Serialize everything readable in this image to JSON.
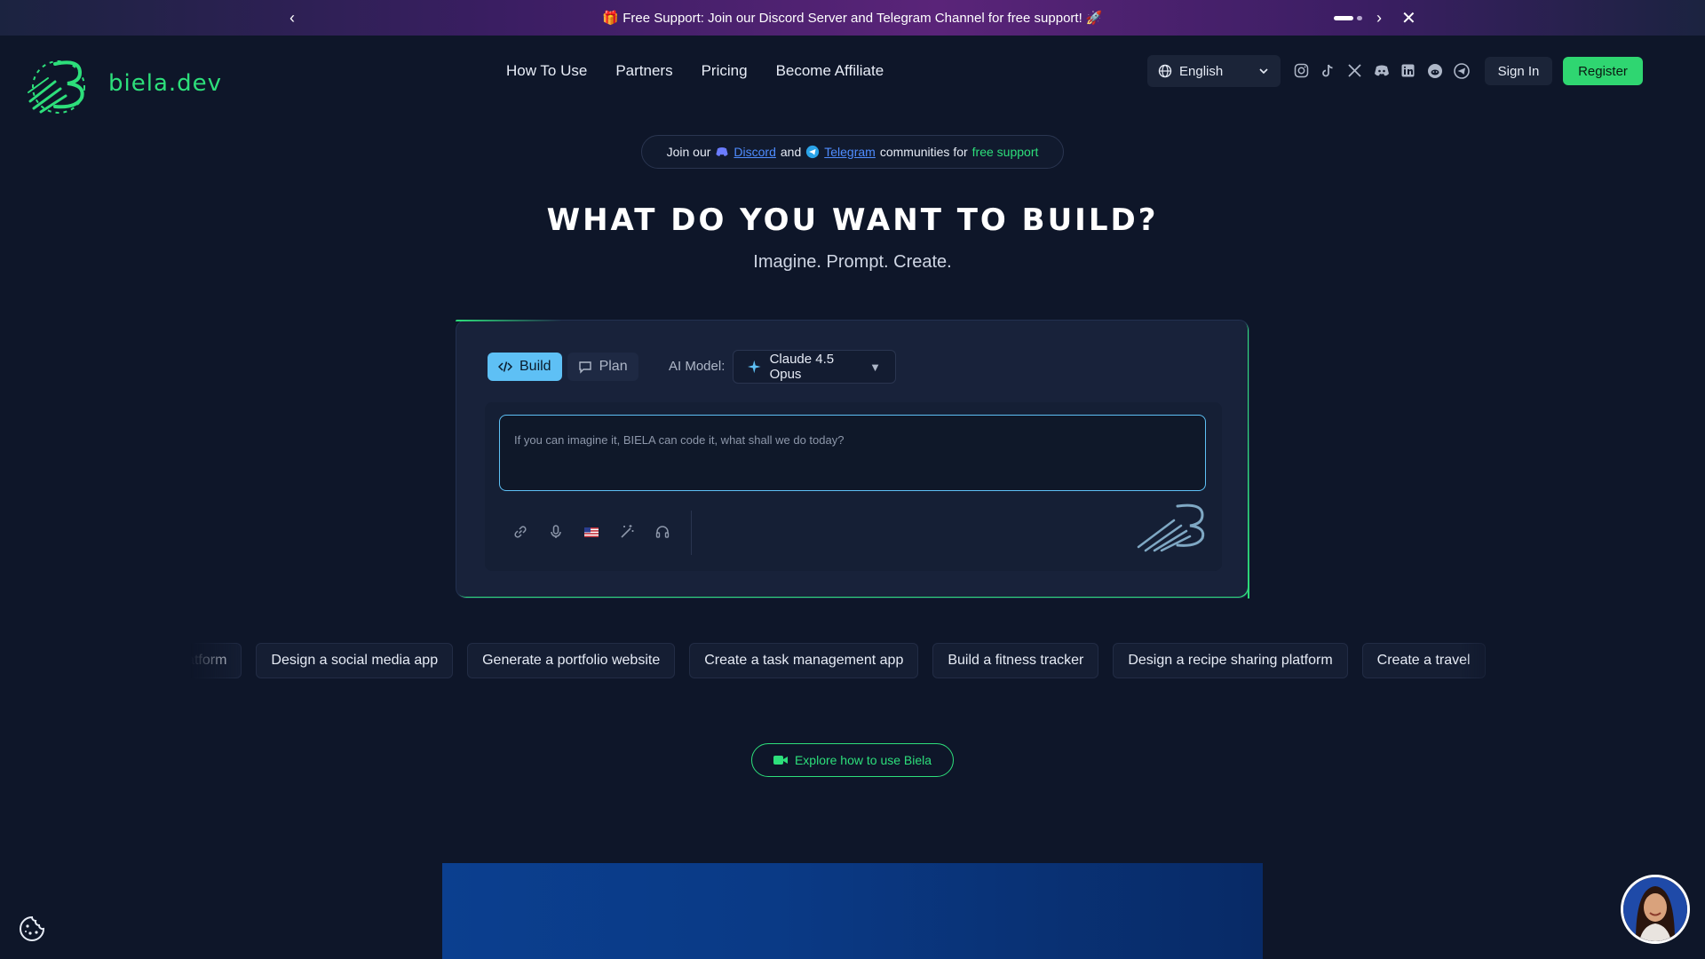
{
  "banner": {
    "gift_emoji": "🎁",
    "text": "Free Support: Join our Discord Server and Telegram Channel for free support!",
    "rocket_emoji": "🚀"
  },
  "logo": {
    "text": "biela.dev"
  },
  "nav": {
    "items": [
      {
        "label": "How To Use"
      },
      {
        "label": "Partners"
      },
      {
        "label": "Pricing"
      },
      {
        "label": "Become Affiliate"
      }
    ]
  },
  "language": {
    "selected": "English"
  },
  "socials": [
    "instagram-icon",
    "tiktok-icon",
    "x-icon",
    "discord-icon",
    "linkedin-icon",
    "reddit-icon",
    "telegram-icon"
  ],
  "auth": {
    "signin": "Sign In",
    "register": "Register"
  },
  "community": {
    "prefix": "Join our",
    "discord": "Discord",
    "and": "and",
    "telegram": "Telegram",
    "middle": "communities for",
    "free": "free support"
  },
  "hero": {
    "title": "WHAT DO YOU WANT TO BUILD?",
    "subtitle": "Imagine. Prompt. Create."
  },
  "composer": {
    "modes": [
      {
        "label": "Build",
        "active": true
      },
      {
        "label": "Plan",
        "active": false
      }
    ],
    "ai_label": "AI Model:",
    "model": "Claude 4.5 Opus",
    "placeholder": "If you can imagine it, BIELA can code it, what shall we do today?"
  },
  "suggestions": [
    "Build an e-commerce platform",
    "Design a social media app",
    "Generate a portfolio website",
    "Create a task management app",
    "Build a fitness tracker",
    "Design a recipe sharing platform",
    "Create a travel"
  ],
  "explore": {
    "label": "Explore how to use Biela"
  },
  "colors": {
    "accent_green": "#2ddf7b",
    "accent_blue": "#5ec0f5",
    "background": "#0e1629"
  }
}
